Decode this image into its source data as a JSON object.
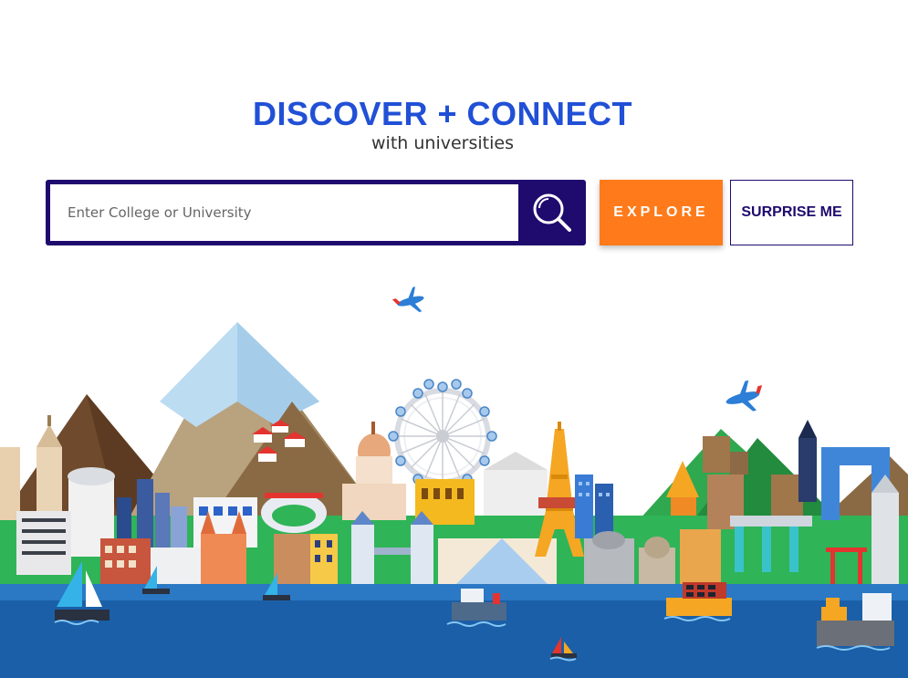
{
  "hero": {
    "title": "DISCOVER + CONNECT",
    "subtitle": "with universities"
  },
  "search": {
    "placeholder": "Enter College or University",
    "value": ""
  },
  "buttons": {
    "explore": "EXPLORE",
    "surprise": "SURPRISE ME"
  },
  "colors": {
    "brand_blue": "#2150d6",
    "navy": "#1f0a6e",
    "orange": "#ff7a1a",
    "water": "#1a5fa8"
  },
  "icons": {
    "search": "search-icon",
    "airplane": "airplane-icon"
  }
}
